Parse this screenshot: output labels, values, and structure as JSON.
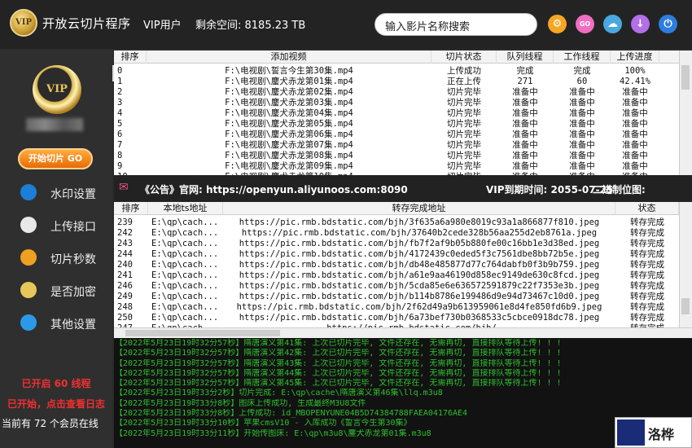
{
  "app": {
    "title": "开放云切片程序",
    "vip_label": "VIP用户",
    "space": "剩余空间: 8185.23 TB",
    "logo_text": "VIP"
  },
  "search": {
    "placeholder": "输入影片名称搜索"
  },
  "toolbar_icons": [
    {
      "name": "gear-icon",
      "color": "#f5a623",
      "glyph": "⚙"
    },
    {
      "name": "go-icon",
      "color": "#f06ec0",
      "glyph": "GO"
    },
    {
      "name": "cloud-icon",
      "color": "#4aa8e0",
      "glyph": "☁"
    },
    {
      "name": "download-icon",
      "color": "#b36ee8",
      "glyph": "↓"
    },
    {
      "name": "power-icon",
      "color": "#2d7de0",
      "glyph": "⏻"
    }
  ],
  "sidebar": {
    "badge_text": "VIP",
    "start_label": "开始切片 GO",
    "items": [
      {
        "name": "watermark",
        "label": "水印设置",
        "color": "#1b7fd8"
      },
      {
        "name": "upload",
        "label": "上传接口",
        "color": "#e8e8e8"
      },
      {
        "name": "seconds",
        "label": "切片秒数",
        "color": "#f0a020"
      },
      {
        "name": "encrypt",
        "label": "是否加密",
        "color": "#e6c85a"
      },
      {
        "name": "other",
        "label": "其他设置",
        "color": "#2a9ae8"
      }
    ],
    "status_threads": "已开启 60 线程",
    "status_log": "已开始，点击查看日志",
    "status_members": "当前有 72 个会员在线"
  },
  "table1": {
    "headers": [
      "排序",
      "添加视频",
      "切片状态",
      "队列线程",
      "工作线程",
      "上传进度",
      "水印状态"
    ],
    "rows": [
      [
        "0",
        "F:\\电视剧\\誓言今生第30集.mp4",
        "上传成功",
        "完成",
        "完成",
        "100%",
        "待添加"
      ],
      [
        "1",
        "F:\\电视剧\\鏖犬赤龙第01集.mp4",
        "正在上传",
        "271",
        "60",
        "42.41%",
        "待添加"
      ],
      [
        "2",
        "F:\\电视剧\\鏖犬赤龙第02集.mp4",
        "切片完毕",
        "准备中",
        "准备中",
        "准备中",
        "待添加"
      ],
      [
        "3",
        "F:\\电视剧\\鏖犬赤龙第03集.mp4",
        "切片完毕",
        "准备中",
        "准备中",
        "准备中",
        "待添加"
      ],
      [
        "4",
        "F:\\电视剧\\鏖犬赤龙第04集.mp4",
        "切片完毕",
        "准备中",
        "准备中",
        "准备中",
        "待添加"
      ],
      [
        "5",
        "F:\\电视剧\\鏖犬赤龙第05集.mp4",
        "切片完毕",
        "准备中",
        "准备中",
        "准备中",
        "待添加"
      ],
      [
        "6",
        "F:\\电视剧\\鏖犬赤龙第06集.mp4",
        "切片完毕",
        "准备中",
        "准备中",
        "准备中",
        "待添加"
      ],
      [
        "7",
        "F:\\电视剧\\鏖犬赤龙第07集.mp4",
        "切片完毕",
        "准备中",
        "准备中",
        "准备中",
        "待添加"
      ],
      [
        "8",
        "F:\\电视剧\\鏖犬赤龙第08集.mp4",
        "切片完毕",
        "准备中",
        "准备中",
        "准备中",
        "待添加"
      ],
      [
        "9",
        "F:\\电视剧\\鏖犬赤龙第09集.mp4",
        "切片完毕",
        "准备中",
        "准备中",
        "准备中",
        "待添加"
      ],
      [
        "10",
        "F:\\电视剧\\鏖犬赤龙第10集.mp4",
        "切片完毕",
        "准备中",
        "准备中",
        "准备中",
        "待添加"
      ]
    ]
  },
  "announcement": {
    "notice": "《公告》官网: https://openyun.aliyunoos.com:8090",
    "vip_expiry": "VIP到期时间: 2055-07-25",
    "binary": "二进制位图:"
  },
  "table2": {
    "headers": [
      "排序",
      "本地ts地址",
      "转存完成地址",
      "状态"
    ],
    "rows": [
      [
        "239",
        "E:\\qp\\cach...",
        "https://pic.rmb.bdstatic.com/bjh/3f635a6a980e8019c93a1a866877f810.jpeg",
        "转存完成"
      ],
      [
        "242",
        "E:\\qp\\cach...",
        "https://pic.rmb.bdstatic.com/bjh/37640b2cede328b56aa255d2eb8761a.jpeg",
        "转存完成"
      ],
      [
        "243",
        "E:\\qp\\cach...",
        "https://pic.rmb.bdstatic.com/bjh/fb7f2af9b05b880fe00c16bb1e3d38ed.jpeg",
        "转存完成"
      ],
      [
        "244",
        "E:\\qp\\cach...",
        "https://pic.rmb.bdstatic.com/bjh/4172439c0eded5f3c7561dbe8bb72b5e.jpeg",
        "转存完成"
      ],
      [
        "240",
        "E:\\qp\\cach...",
        "https://pic.rmb.bdstatic.com/bjh/db48e485877d77c764dabfb0f3b9b759.jpeg",
        "转存完成"
      ],
      [
        "241",
        "E:\\qp\\cach...",
        "https://pic.rmb.bdstatic.com/bjh/a61e9aa46190d858ec9149de630c8fcd.jpeg",
        "转存完成"
      ],
      [
        "246",
        "E:\\qp\\cach...",
        "https://pic.rmb.bdstatic.com/bjh/5cda85e6e636572591879c22f7353e3b.jpeg",
        "转存完成"
      ],
      [
        "249",
        "E:\\qp\\cach...",
        "https://pic.rmb.bdstatic.com/bjh/b114b8786e199486d9e94d73467c10d0.jpeg",
        "转存完成"
      ],
      [
        "248",
        "E:\\qp\\cach...",
        "https://pic.rmb.bdstatic.com/bjh/2f62d49a9b613959061e8d4fe850fd6b9.jpeg",
        "转存完成"
      ],
      [
        "250",
        "E:\\qp\\cach...",
        "https://pic.rmb.bdstatic.com/bjh/6a73bef730b0368533c5cbce0918dc78.jpeg",
        "转存完成"
      ],
      [
        "247",
        "E:\\qp\\cach...",
        "https://pic.rmb.bdstatic.com/bjh/...",
        "转存完成"
      ]
    ]
  },
  "log": {
    "lines": [
      "【2022年5月23日19时32分57秒】隋唐演义第41集: 上次已切片完毕, 文件还存在, 无需再切, 直接排队等待上传! ! !",
      "【2022年5月23日19时32分57秒】隋唐演义第42集: 上次已切片完毕, 文件还存在, 无需再切, 直接排队等待上传! ! !",
      "【2022年5月23日19时32分57秒】隋唐演义第43集: 上次已切片完毕, 文件还存在, 无需再切, 直接排队等待上传! ! !",
      "【2022年5月23日19时32分57秒】隋唐演义第44集: 上次已切片完毕, 文件还存在, 无需再切, 直接排队等待上传! ! !",
      "【2022年5月23日19时32分57秒】隋唐演义第45集: 上次已切片完毕, 文件还存在, 无需再切, 直接排队等待上传! ! !",
      "【2022年5月23日19时33分2秒】切片完成: E:\\qp\\cache\\隋唐演义第46集\\llq.m3u8",
      "【2022年5月23日19时33分8秒】图床上传成功, 生成最终M3U8文件",
      "【2022年5月23日19时33分8秒】上传成功: id_MBOPENYUNE04B5D74384788FAEA04176AE4",
      "【2022年5月23日19时33分10秒】苹果cmsV10 - 入库成功《誓言今生第30集》",
      "【2022年5月23日19时33分11秒】开始传图床: E:\\qp\\m3u8\\鏖犬赤龙第01集.m3u8"
    ]
  },
  "qr": {
    "text": "洛桦"
  },
  "colors": {
    "log_text": "#2fbf2f",
    "accent": "#f03030"
  }
}
